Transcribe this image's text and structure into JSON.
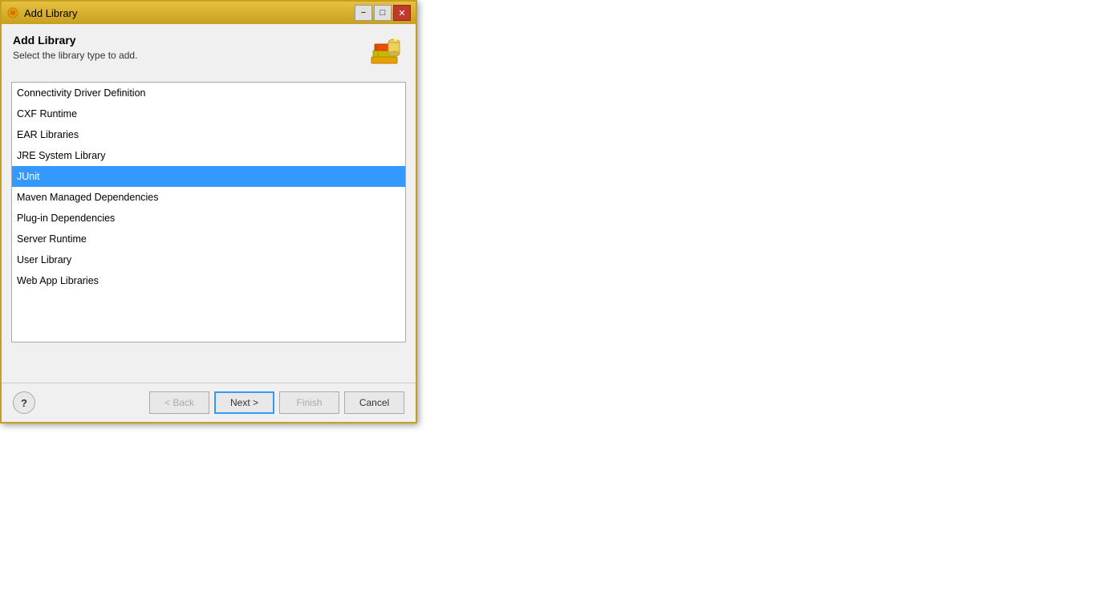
{
  "dialog": {
    "title": "Add Library",
    "icon": "gear-icon"
  },
  "header": {
    "title": "Add Library",
    "subtitle": "Select the library type to add.",
    "icon": "library-icon"
  },
  "library_list": {
    "items": [
      {
        "id": 0,
        "label": "Connectivity Driver Definition",
        "selected": false
      },
      {
        "id": 1,
        "label": "CXF Runtime",
        "selected": false
      },
      {
        "id": 2,
        "label": "EAR Libraries",
        "selected": false
      },
      {
        "id": 3,
        "label": "JRE System Library",
        "selected": false
      },
      {
        "id": 4,
        "label": "JUnit",
        "selected": true
      },
      {
        "id": 5,
        "label": "Maven Managed Dependencies",
        "selected": false
      },
      {
        "id": 6,
        "label": "Plug-in Dependencies",
        "selected": false
      },
      {
        "id": 7,
        "label": "Server Runtime",
        "selected": false
      },
      {
        "id": 8,
        "label": "User Library",
        "selected": false
      },
      {
        "id": 9,
        "label": "Web App Libraries",
        "selected": false
      }
    ]
  },
  "buttons": {
    "help_label": "?",
    "back_label": "< Back",
    "next_label": "Next >",
    "finish_label": "Finish",
    "cancel_label": "Cancel"
  },
  "titlebar": {
    "minimize_label": "−",
    "maximize_label": "□",
    "close_label": "✕"
  }
}
